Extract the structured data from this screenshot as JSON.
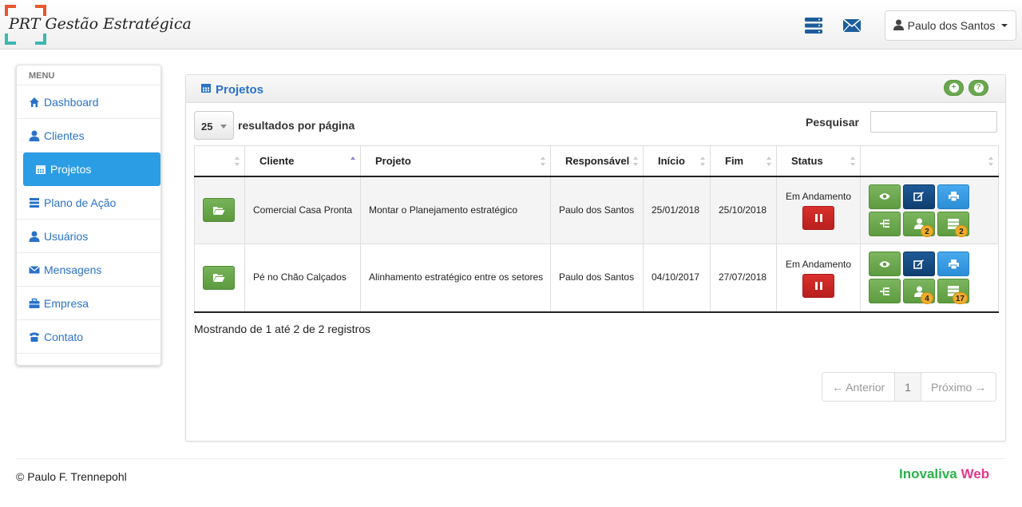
{
  "brand": {
    "name": "PRT Gestão Estratégica"
  },
  "header": {
    "user_name": "Paulo dos Santos",
    "icons": [
      "server-icon",
      "envelope-icon",
      "user-icon"
    ]
  },
  "sidebar": {
    "title": "MENU",
    "items": [
      {
        "label": "Dashboard",
        "icon": "home-icon"
      },
      {
        "label": "Clientes",
        "icon": "user-icon"
      },
      {
        "label": "Projetos",
        "icon": "calendar-icon",
        "active": true
      },
      {
        "label": "Plano de Ação",
        "icon": "server-icon"
      },
      {
        "label": "Usuários",
        "icon": "user-icon"
      },
      {
        "label": "Mensagens",
        "icon": "envelope-icon"
      },
      {
        "label": "Empresa",
        "icon": "briefcase-icon"
      },
      {
        "label": "Contato",
        "icon": "phone-icon"
      }
    ]
  },
  "panel": {
    "title": "Projetos",
    "page_length": "25",
    "page_length_label": "resultados por página",
    "search_label": "Pesquisar",
    "search_value": "",
    "columns": [
      "",
      "Cliente",
      "Projeto",
      "Responsável",
      "Início",
      "Fim",
      "Status",
      ""
    ],
    "rows": [
      {
        "cliente": "Comercial Casa Pronta",
        "projeto": "Montar o Planejamento estratégico",
        "responsavel": "Paulo dos Santos",
        "inicio": "25/01/2018",
        "fim": "25/10/2018",
        "status": "Em Andamento",
        "badge_users": "2",
        "badge_plans": "2"
      },
      {
        "cliente": "Pé no Chão Calçados",
        "projeto": "Alinhamento estratégico entre os setores",
        "responsavel": "Paulo dos Santos",
        "inicio": "04/10/2017",
        "fim": "27/07/2018",
        "status": "Em Andamento",
        "badge_users": "4",
        "badge_plans": "17"
      }
    ],
    "info": "Mostrando de 1 até 2 de 2 registros",
    "pagination": {
      "prev": "← Anterior",
      "current": "1",
      "next": "Próximo →"
    }
  },
  "footer": {
    "copyright": "© Paulo F. Trennepohl",
    "logo_a": "Inovaliva",
    "logo_b": "Web"
  },
  "colors": {
    "accent": "#2b9de5",
    "link": "#2a72c8",
    "green": "#6aa84f",
    "navy": "#1d5a97",
    "red": "#d9302c",
    "badge": "#f0ad2c"
  }
}
